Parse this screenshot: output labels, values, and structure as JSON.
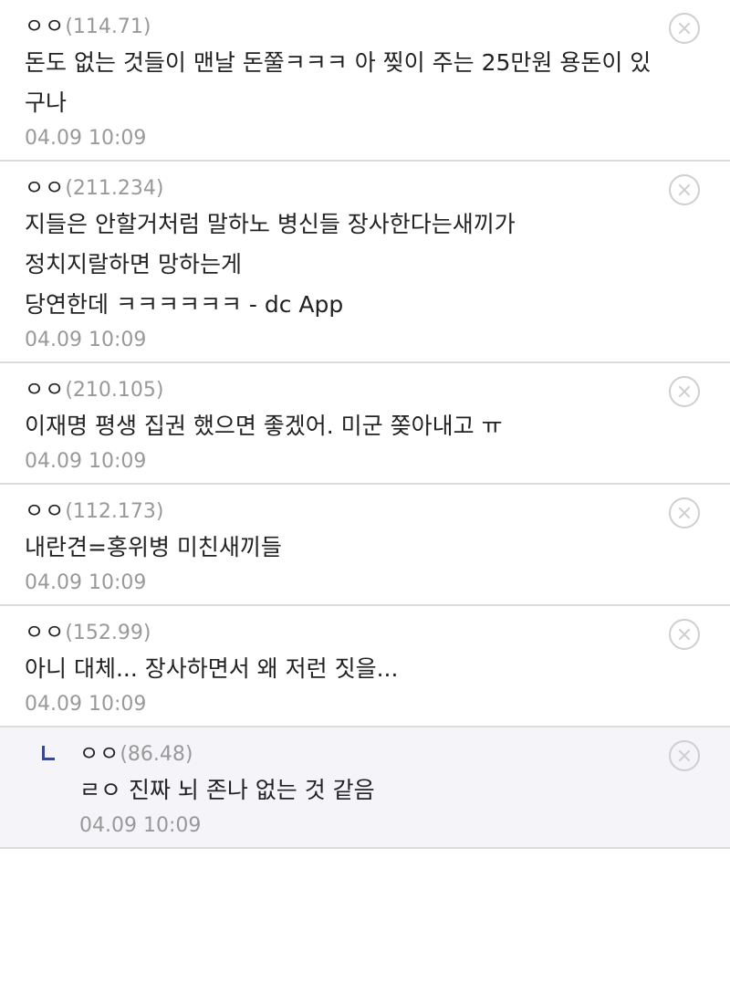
{
  "comments": [
    {
      "nick": "ㅇㅇ",
      "ip": "(114.71)",
      "lines": [
        "돈도 없는 것들이 맨날 돈쭐ㅋㅋㅋ 아 찢이 주는 25만원 용돈이 있",
        "구나"
      ],
      "date": "04.09 10:09",
      "reply": false
    },
    {
      "nick": "ㅇㅇ",
      "ip": "(211.234)",
      "lines": [
        "지들은 안할거처럼 말하노 병신들 장사한다는새끼가",
        "정치지랄하면 망하는게",
        "당연한데 ㅋㅋㅋㅋㅋㅋ - dc App"
      ],
      "date": "04.09 10:09",
      "reply": false
    },
    {
      "nick": "ㅇㅇ",
      "ip": "(210.105)",
      "lines": [
        "이재명 평생 집권 했으면 좋겠어. 미군 쫒아내고 ㅠ"
      ],
      "date": "04.09 10:09",
      "reply": false
    },
    {
      "nick": "ㅇㅇ",
      "ip": "(112.173)",
      "lines": [
        "내란견=홍위병 미친새끼들"
      ],
      "date": "04.09 10:09",
      "reply": false
    },
    {
      "nick": "ㅇㅇ",
      "ip": "(152.99)",
      "lines": [
        "아니 대체... 장사하면서 왜 저런 짓을..."
      ],
      "date": "04.09 10:09",
      "reply": false
    },
    {
      "nick": "ㅇㅇ",
      "ip": "(86.48)",
      "lines": [
        "ㄹㅇ 진짜 뇌 존나 없는 것 같음"
      ],
      "date": "04.09 10:09",
      "reply": true
    }
  ],
  "icons": {
    "delete": "close-circle-icon",
    "reply": "reply-arrow-icon"
  },
  "colors": {
    "divider": "#dcdcdc",
    "meta": "#999999",
    "reply_bg": "#f4f4f9",
    "reply_mark": "#3b4890"
  }
}
